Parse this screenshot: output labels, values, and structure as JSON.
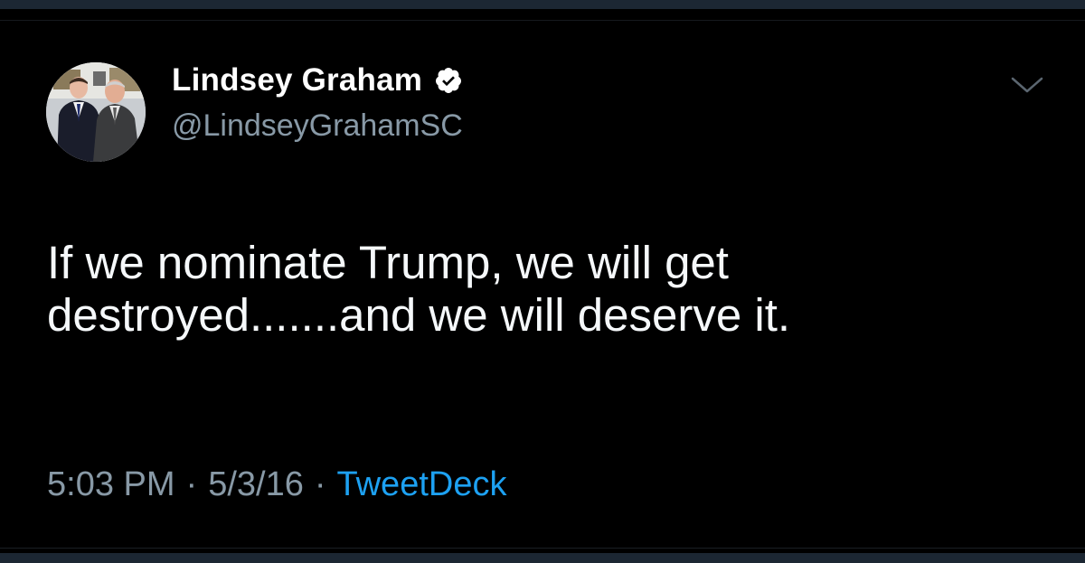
{
  "tweet": {
    "author": {
      "display_name": "Lindsey Graham",
      "handle": "@LindseyGrahamSC",
      "verified": true,
      "avatar_icon": "profile-photo-two-men-in-suits"
    },
    "text_lines": [
      "If we nominate Trump, we will get",
      "destroyed.......and we will deserve it."
    ],
    "time": "5:03 PM",
    "date": "5/3/16",
    "separator": "·",
    "source": "TweetDeck",
    "menu_icon": "chevron-down-icon"
  },
  "colors": {
    "background": "#000000",
    "text": "#f5f8fa",
    "muted": "#8899a6",
    "link": "#1da1f2",
    "bar": "#1c2733"
  }
}
